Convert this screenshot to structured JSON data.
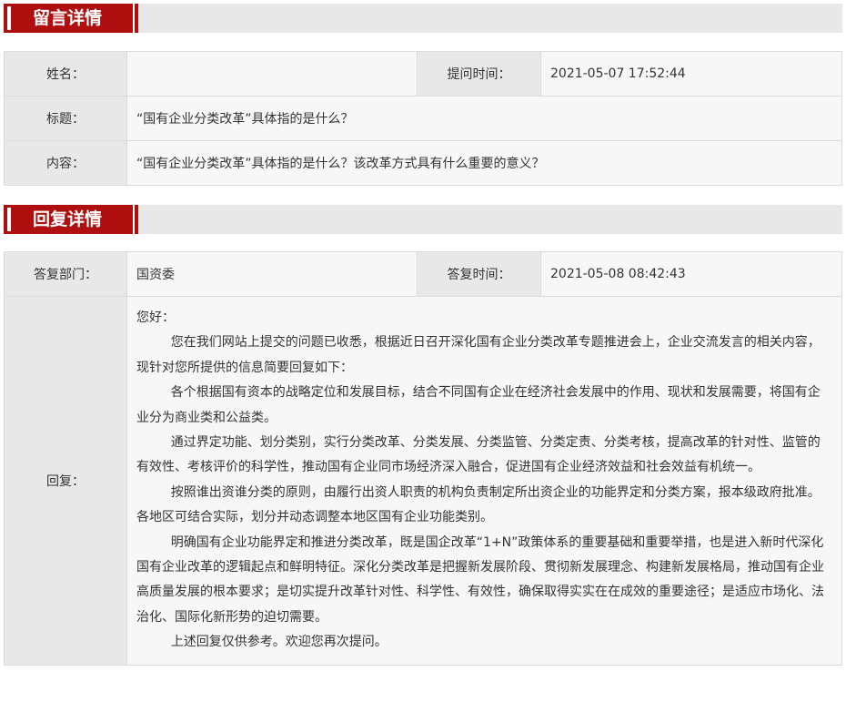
{
  "message_section": {
    "title": "留言详情",
    "name_label": "姓名：",
    "name_value": "",
    "ask_time_label": "提问时间：",
    "ask_time_value": "2021-05-07 17:52:44",
    "subject_label": "标题：",
    "subject_value": "“国有企业分类改革”具体指的是什么？",
    "content_label": "内容：",
    "content_value": "“国有企业分类改革”具体指的是什么？该改革方式具有什么重要的意义？"
  },
  "reply_section": {
    "title": "回复详情",
    "dept_label": "答复部门：",
    "dept_value": "国资委",
    "reply_time_label": "答复时间：",
    "reply_time_value": "2021-05-08 08:42:43",
    "reply_label": "回复：",
    "greeting": "您好：",
    "paragraphs": [
      "您在我们网站上提交的问题已收悉，根据近日召开深化国有企业分类改革专题推进会上，企业交流发言的相关内容，现针对您所提供的信息简要回复如下：",
      "各个根据国有资本的战略定位和发展目标，结合不同国有企业在经济社会发展中的作用、现状和发展需要，将国有企业分为商业类和公益类。",
      "通过界定功能、划分类别，实行分类改革、分类发展、分类监管、分类定责、分类考核，提高改革的针对性、监管的有效性、考核评价的科学性，推动国有企业同市场经济深入融合，促进国有企业经济效益和社会效益有机统一。",
      "按照谁出资谁分类的原则，由履行出资人职责的机构负责制定所出资企业的功能界定和分类方案，报本级政府批准。各地区可结合实际，划分并动态调整本地区国有企业功能类别。",
      "明确国有企业功能界定和推进分类改革，既是国企改革“1+N”政策体系的重要基础和重要举措，也是进入新时代深化国有企业改革的逻辑起点和鲜明特征。深化分类改革是把握新发展阶段、贯彻新发展理念、构建新发展格局，推动国有企业高质量发展的根本要求；是切实提升改革针对性、科学性、有效性，确保取得实实在在成效的重要途径；是适应市场化、法治化、国际化新形势的迫切需要。",
      "上述回复仅供参考。欢迎您再次提问。"
    ]
  },
  "colors": {
    "accent": "#b00f0f",
    "header_bg": "#e8e8e8",
    "cell_bg": "#f7f7f7",
    "border": "#dcdcdc"
  }
}
